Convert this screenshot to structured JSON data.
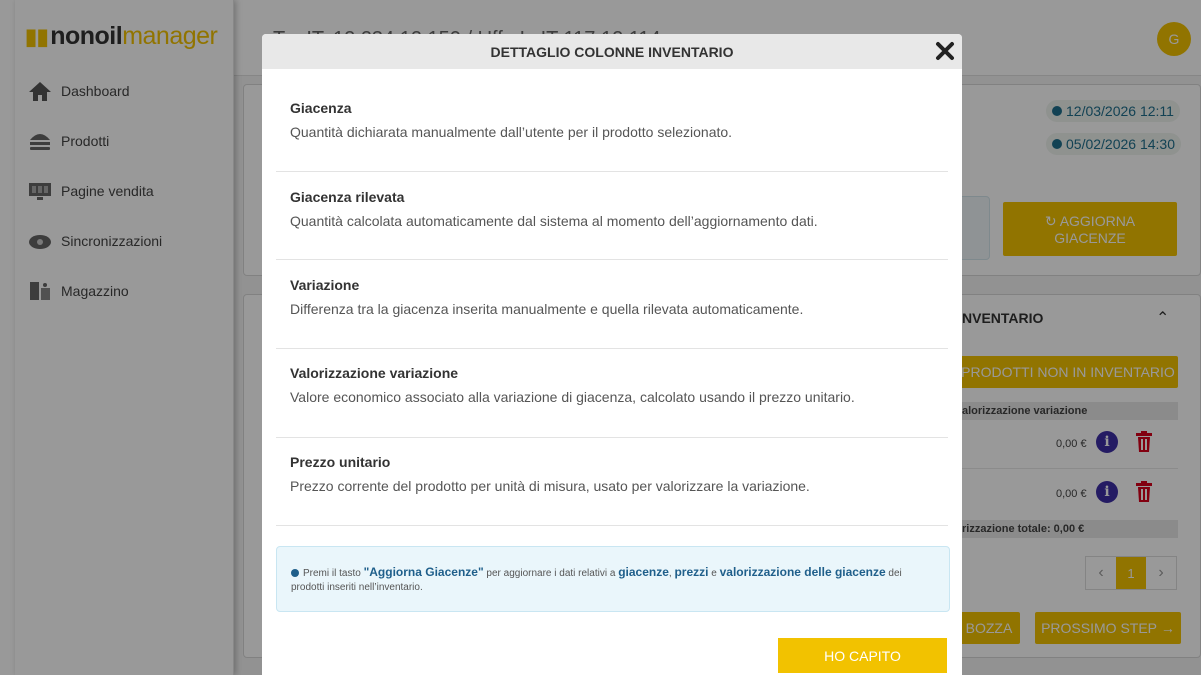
{
  "app": {
    "logo_part1": "nonoil",
    "logo_part2": "manager",
    "title_partial": "Tar IT, 12 234 12 150 / Uffe Ic IT 117 12 114 ..."
  },
  "sidebar": {
    "items": [
      {
        "label": "Dashboard",
        "icon": "home-icon"
      },
      {
        "label": "Prodotti",
        "icon": "burger-icon"
      },
      {
        "label": "Pagine vendita",
        "icon": "monitor-icon"
      },
      {
        "label": "Sincronizzazioni",
        "icon": "cloud-sync-icon"
      },
      {
        "label": "Magazzino",
        "icon": "warehouse-icon"
      }
    ]
  },
  "header": {
    "avatar_initial": "G"
  },
  "background": {
    "date1": "12/03/2026 12:11",
    "date2": "05/02/2026 14:30",
    "aggiorna_line1": "AGGIORNA",
    "aggiorna_line2": "GIACENZE",
    "section_title": "NVENTARIO",
    "prodotti_non_btn": "PRODOTTI NON IN INVENTARIO",
    "col_header": "alorizzazione variazione",
    "row_values": [
      "0,00 €",
      "0,00 €"
    ],
    "total_label": "rizzazione totale: 0,00 €",
    "page_number": "1",
    "bozza_btn": "BOZZA",
    "prossimo_btn": "PROSSIMO STEP"
  },
  "modal": {
    "title": "DETTAGLIO COLONNE INVENTARIO",
    "sections": [
      {
        "title": "Giacenza",
        "description": "Quantità dichiarata manualmente dall’utente per il prodotto selezionato."
      },
      {
        "title": "Giacenza rilevata",
        "description": "Quantità calcolata automaticamente dal sistema al momento dell’aggiornamento dati."
      },
      {
        "title": "Variazione",
        "description": "Differenza tra la giacenza inserita manualmente e quella rilevata automaticamente."
      },
      {
        "title": "Valorizzazione variazione",
        "description": "Valore economico associato alla variazione di giacenza, calcolato usando il prezzo unitario."
      },
      {
        "title": "Prezzo unitario",
        "description": "Prezzo corrente del prodotto per unità di misura, usato per valorizzare la variazione."
      }
    ],
    "info": {
      "pre": "Premi il tasto ",
      "btn_name": "\"Aggiorna Giacenze\"",
      "mid": " per aggiornare i dati relativi a ",
      "k1": "giacenze",
      "sep1": ", ",
      "k2": "prezzi",
      "sep2": " e ",
      "k3": "valorizzazione delle giacenze",
      "post": " dei prodotti inseriti nell’inventario."
    },
    "ok_label": "HO CAPITO"
  },
  "colors": {
    "accent": "#f2c200",
    "info_blue": "#1f5f8b",
    "icon_purple": "#3c2ea6",
    "delete_red": "#d9001b"
  }
}
